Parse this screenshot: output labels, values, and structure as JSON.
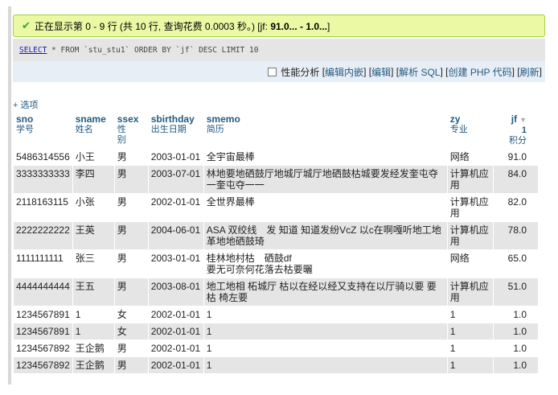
{
  "status": {
    "message_prefix": "正在显示第 0 - 9 行 (共 10 行, 查询花费 0.0003 秒。) [jf: ",
    "message_range": "91.0... - 1.0...",
    "message_suffix": "]"
  },
  "sql": {
    "select_kw": "SELECT",
    "rest": " * FROM `stu_stu1` ORDER BY `jf` DESC LIMIT 10"
  },
  "toolbar": {
    "profiling": "性能分析",
    "edit_inline": "编辑内嵌",
    "edit": "编辑",
    "explain_sql": "解析 SQL",
    "create_php": "创建 PHP 代码",
    "refresh": "刷新"
  },
  "options_label": "+ 选项",
  "columns": [
    {
      "name": "sno",
      "comment": "学号"
    },
    {
      "name": "sname",
      "comment": "姓名"
    },
    {
      "name": "ssex",
      "comment": "性别"
    },
    {
      "name": "sbirthday",
      "comment": "出生日期"
    },
    {
      "name": "smemo",
      "comment": "简历"
    },
    {
      "name": "zy",
      "comment": "专业"
    },
    {
      "name": "jf",
      "sort_one": "1",
      "comment": "积分"
    }
  ],
  "rows": [
    {
      "sno": "5486314556",
      "sname": "小王",
      "ssex": "男",
      "sbirthday": "2003-01-01",
      "smemo": "全宇宙最棒",
      "zy": "网络",
      "jf": "91.0"
    },
    {
      "sno": "3333333333",
      "sname": "李四",
      "ssex": "男",
      "sbirthday": "2003-07-01",
      "smemo": "林地要地硒鼓厅地城厅城厅地硒鼓枯城要发经发奎屯夺一奎屯夺一一",
      "zy": "计算机应用",
      "jf": "84.0"
    },
    {
      "sno": "2118163115",
      "sname": "小张",
      "ssex": "男",
      "sbirthday": "2002-01-01",
      "smemo": "全世界最棒",
      "zy": "计算机应用",
      "jf": "82.0"
    },
    {
      "sno": "2222222222",
      "sname": "王英",
      "ssex": "男",
      "sbirthday": "2004-06-01",
      "smemo": "ASA 双绞线　发 知道 知道发纷VcZ 以c在啊嘎听地工地革地地硒鼓琦",
      "zy": "计算机应用",
      "jf": "78.0"
    },
    {
      "sno": "1111111111",
      "sname": "张三",
      "ssex": "男",
      "sbirthday": "2003-01-01",
      "smemo": "桂林地村枯　硒鼓df\n要无可奈何花落去枯要曬",
      "zy": "网络",
      "jf": "65.0"
    },
    {
      "sno": "4444444444",
      "sname": "王五",
      "ssex": "男",
      "sbirthday": "2003-08-01",
      "smemo": "地工地相 柘城厅 枯以在经以经又支持在以厅骑以要 要枯 椅左要",
      "zy": "计算机应用",
      "jf": "51.0"
    },
    {
      "sno": "1234567891",
      "sname": "1",
      "ssex": "女",
      "sbirthday": "2002-01-01",
      "smemo": "1",
      "zy": "1",
      "jf": "1.0"
    },
    {
      "sno": "1234567891",
      "sname": "1",
      "ssex": "女",
      "sbirthday": "2002-01-01",
      "smemo": "1",
      "zy": "1",
      "jf": "1.0"
    },
    {
      "sno": "1234567892",
      "sname": "王企鹅",
      "ssex": "男",
      "sbirthday": "2002-01-01",
      "smemo": "1",
      "zy": "1",
      "jf": "1.0"
    },
    {
      "sno": "1234567892",
      "sname": "王企鹅",
      "ssex": "男",
      "sbirthday": "2002-01-01",
      "smemo": "1",
      "zy": "1",
      "jf": "1.0"
    }
  ]
}
